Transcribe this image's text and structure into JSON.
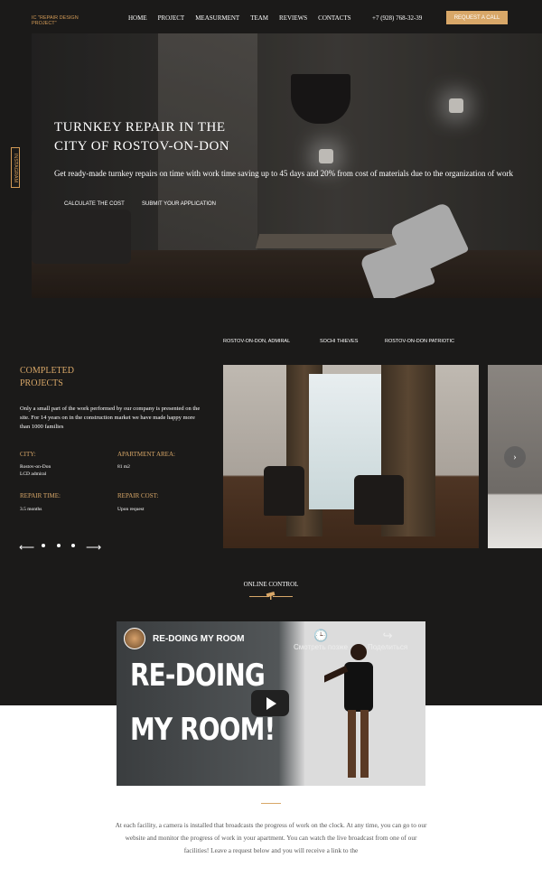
{
  "header": {
    "logo": "IC \"REPAIR DESIGN PROJECT\"",
    "nav": [
      "HOME",
      "PROJECT",
      "MEASURMENT",
      "TEAM",
      "REVIEWS",
      "CONTACTS"
    ],
    "phone": "+7 (928) 768-32-39",
    "request_button": "REQUEST A CALL"
  },
  "side": {
    "instagram": "INSTAGRAM"
  },
  "hero": {
    "title_line1": "TURNKEY REPAIR IN THE",
    "title_line2": "CITY OF ROSTOV-ON-DON",
    "subtitle": "Get ready-made turnkey repairs on time with work time saving up to 45 days and 20% from cost of materials due to the organization of work",
    "calc_link": "CALCULATE THE COST",
    "submit_link": "SUBMIT YOUR APPLICATION"
  },
  "projects": {
    "tabs": [
      "ROSTOV-ON-DON, ADMIRAL",
      "SOCHI THIEVES",
      "ROSTOV-ON-DON PATRIOTIC"
    ],
    "title_line1": "COMPLETED",
    "title_line2": "PROJECTS",
    "text": "Only a small part of the work performed by our company is presented on the site. For 14 years on in the construction market we have made happy more than 1000 families",
    "city_label": "CITY:",
    "city_value_line1": "Rostov-on-Don",
    "city_value_line2": "LCD admiral",
    "area_label": "APARTMENT AREA:",
    "area_value": "81 m2",
    "time_label": "REPAIR TIME:",
    "time_value": "3.5 months",
    "cost_label": "REPAIR COST:",
    "cost_value": "Upon request",
    "prev_arrow": "⟵",
    "next_arrow": "⟶",
    "slider_next": "›"
  },
  "online": {
    "title": "ONLINE CONTROL",
    "video_title": "RE-DOING MY ROOM",
    "video_big_line1": "RE-DOING",
    "video_big_line2": "MY ROOM!",
    "watch_later": "Смотреть позже",
    "share": "Поделиться",
    "description": "At each facility, a camera is installed that broadcasts the progress of work on the clock. At any time, you can go to our website and monitor the progress of work in your apartment. You can watch the live broadcast from one of our facilities! Leave a request below and you will receive a link to the"
  },
  "colors": {
    "accent": "#d8a768",
    "dark_bg": "#1b1a19"
  }
}
